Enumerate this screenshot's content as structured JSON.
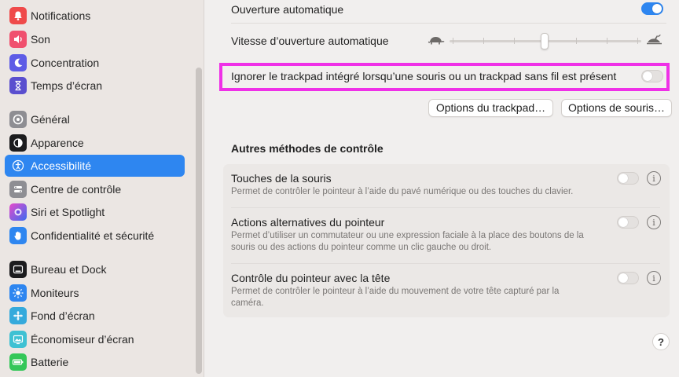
{
  "sidebar": {
    "items": [
      {
        "label": "Notifications",
        "icon": "bell-icon",
        "color": "#ef4a4a"
      },
      {
        "label": "Son",
        "icon": "speaker-icon",
        "color": "#f0506e"
      },
      {
        "label": "Concentration",
        "icon": "moon-icon",
        "color": "#5e5ce6"
      },
      {
        "label": "Temps d’écran",
        "icon": "hourglass-icon",
        "color": "#5a4fcf"
      },
      {
        "label": "Général",
        "icon": "gear-icon",
        "color": "#8e8e93"
      },
      {
        "label": "Apparence",
        "icon": "appearance-icon",
        "color": "#1c1c1e"
      },
      {
        "label": "Accessibilité",
        "icon": "accessibility-icon",
        "color": "#2e86f0"
      },
      {
        "label": "Centre de contrôle",
        "icon": "control-center-icon",
        "color": "#8e8e93"
      },
      {
        "label": "Siri et Spotlight",
        "icon": "siri-icon",
        "color": "#b03dd8"
      },
      {
        "label": "Confidentialité et sécurité",
        "icon": "hand-icon",
        "color": "#2e86f0"
      },
      {
        "label": "Bureau et Dock",
        "icon": "dock-icon",
        "color": "#1c1c1e"
      },
      {
        "label": "Moniteurs",
        "icon": "sun-icon",
        "color": "#2e86f0"
      },
      {
        "label": "Fond d’écran",
        "icon": "wallpaper-icon",
        "color": "#35aadc"
      },
      {
        "label": "Économiseur d’écran",
        "icon": "screensaver-icon",
        "color": "#3ec1d3"
      },
      {
        "label": "Batterie",
        "icon": "battery-icon",
        "color": "#34c759"
      }
    ],
    "selected": "Accessibilité"
  },
  "main": {
    "auto_open_label": "Ouverture automatique",
    "auto_open_on": true,
    "auto_open_speed_label": "Vitesse d’ouverture automatique",
    "speed_slider_value": 0.5,
    "ignore_trackpad_label": "Ignorer le trackpad intégré lorsqu’une souris ou un trackpad sans fil est présent",
    "ignore_trackpad_on": false,
    "trackpad_options_button": "Options du trackpad…",
    "mouse_options_button": "Options de souris…",
    "other_methods_title": "Autres méthodes de contrôle",
    "options": [
      {
        "title": "Touches de la souris",
        "description": "Permet de contrôler le pointeur à l’aide du pavé numérique ou des touches du clavier.",
        "on": false
      },
      {
        "title": "Actions alternatives du pointeur",
        "description": "Permet d’utiliser un commutateur ou une expression faciale à la place des boutons de la souris ou des actions du pointeur comme un clic gauche ou droit.",
        "on": false
      },
      {
        "title": "Contrôle du pointeur avec la tête",
        "description": "Permet de contrôler le pointeur à l’aide du mouvement de votre tête capturé par la caméra.",
        "on": false
      }
    ],
    "help_label": "?"
  },
  "colors": {
    "accent": "#2e86f0",
    "highlight": "#ef30e7"
  }
}
